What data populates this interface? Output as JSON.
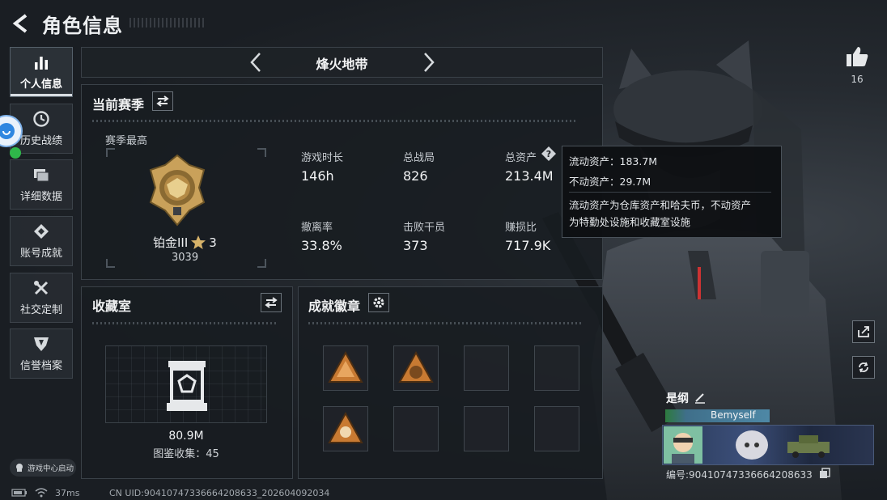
{
  "header": {
    "title": "角色信息"
  },
  "nav": {
    "items": [
      {
        "label": "个人信息",
        "icon": "bar-chart-icon",
        "active": true
      },
      {
        "label": "历史战绩",
        "icon": "clock-icon"
      },
      {
        "label": "详细数据",
        "icon": "folder-icon"
      },
      {
        "label": "账号成就",
        "icon": "diamond-icon"
      },
      {
        "label": "社交定制",
        "icon": "tools-icon"
      },
      {
        "label": "信誉档案",
        "icon": "shield-icon"
      }
    ]
  },
  "mode_tab": {
    "title": "烽火地带"
  },
  "season": {
    "title": "当前赛季",
    "best_label": "赛季最高",
    "rank_name": "铂金III",
    "rank_stars": "3",
    "rank_points": "3039",
    "stats": [
      {
        "label": "游戏时长",
        "value": "146h"
      },
      {
        "label": "总战局",
        "value": "826"
      },
      {
        "label": "总资产",
        "value": "213.4M"
      },
      {
        "label": "撤离率",
        "value": "33.8%"
      },
      {
        "label": "击败干员",
        "value": "373"
      },
      {
        "label": "赚损比",
        "value": "717.9K"
      }
    ]
  },
  "tooltip": {
    "line1": "流动资产：183.7M",
    "line2": "不动资产：29.7M",
    "desc1": "流动资产为仓库资产和哈夫币，不动资产",
    "desc2": "为特勤处设施和收藏室设施"
  },
  "collection": {
    "title": "收藏室",
    "value": "80.9M",
    "collect_text": "图鉴收集：45"
  },
  "achievements": {
    "title": "成就徽章",
    "slots_filled": 3,
    "slots_total": 8
  },
  "player": {
    "likes": "16",
    "name": "是纲",
    "tag": "Bemyself",
    "id_text": "编号:90410747336664208633"
  },
  "footer": {
    "game_center": "游戏中心启动",
    "ping": "37ms",
    "uid": "CN UID:90410747336664208633_202604092034"
  },
  "colors": {
    "accent": "#ffffff",
    "gold": "#c9a15a",
    "tag_bg": "#3f6f8a",
    "badge_orange": "#c87a32"
  }
}
